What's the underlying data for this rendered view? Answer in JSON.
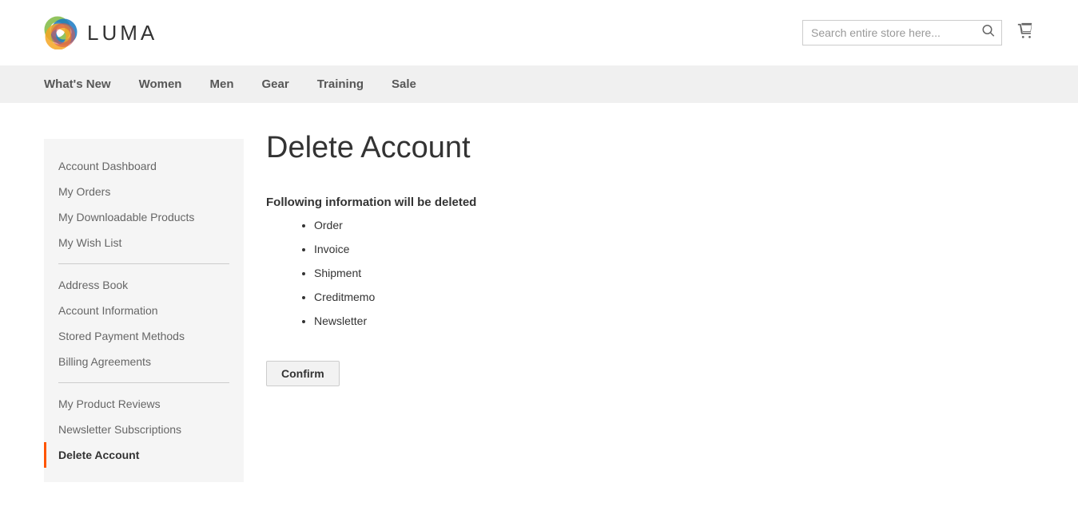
{
  "logo": {
    "text": "LUMA"
  },
  "search": {
    "placeholder": "Search entire store here..."
  },
  "nav": {
    "items": [
      {
        "label": "What's New"
      },
      {
        "label": "Women"
      },
      {
        "label": "Men"
      },
      {
        "label": "Gear"
      },
      {
        "label": "Training"
      },
      {
        "label": "Sale"
      }
    ]
  },
  "sidebar": {
    "group1": [
      {
        "label": "Account Dashboard"
      },
      {
        "label": "My Orders"
      },
      {
        "label": "My Downloadable Products"
      },
      {
        "label": "My Wish List"
      }
    ],
    "group2": [
      {
        "label": "Address Book"
      },
      {
        "label": "Account Information"
      },
      {
        "label": "Stored Payment Methods"
      },
      {
        "label": "Billing Agreements"
      }
    ],
    "group3": [
      {
        "label": "My Product Reviews"
      },
      {
        "label": "Newsletter Subscriptions"
      },
      {
        "label": "Delete Account",
        "active": true
      }
    ]
  },
  "page": {
    "title": "Delete Account",
    "section_heading": "Following information will be deleted",
    "delete_items": [
      "Order",
      "Invoice",
      "Shipment",
      "Creditmemo",
      "Newsletter"
    ],
    "confirm_label": "Confirm"
  }
}
